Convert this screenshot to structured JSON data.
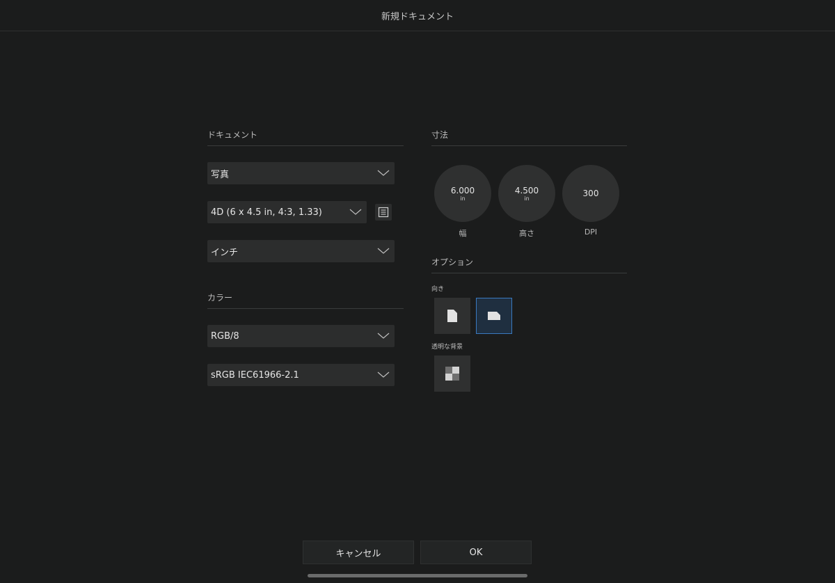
{
  "window": {
    "title": "新規ドキュメント"
  },
  "document_section": {
    "title": "ドキュメント",
    "preset_type": "写真",
    "preset_size": "4D  (6 x 4.5 in, 4:3, 1.33)",
    "units": "インチ"
  },
  "color_section": {
    "title": "カラー",
    "mode": "RGB/8",
    "profile": "sRGB IEC61966-2.1"
  },
  "dimensions_section": {
    "title": "寸法",
    "width": {
      "value": "6.000",
      "unit": "in",
      "label": "幅"
    },
    "height": {
      "value": "4.500",
      "unit": "in",
      "label": "高さ"
    },
    "dpi": {
      "value": "300",
      "label": "DPI"
    }
  },
  "options_section": {
    "title": "オプション",
    "orientation_label": "向き",
    "orientation_selected": "landscape",
    "transparent_bg_label": "透明な背景"
  },
  "footer": {
    "cancel_label": "キャンセル",
    "ok_label": "OK"
  },
  "colors": {
    "background": "#1b1c1c",
    "control": "#2c2d2d",
    "selected_tile": "#1f2f40",
    "selected_border": "#3a7ac0"
  }
}
